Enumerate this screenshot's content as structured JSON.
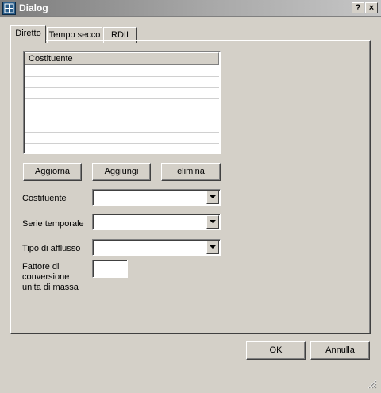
{
  "window": {
    "title": "Dialog",
    "help_label": "?",
    "close_label": "×"
  },
  "tabs": [
    {
      "label": "Diretto",
      "active": true
    },
    {
      "label": "Tempo secco",
      "active": false
    },
    {
      "label": "RDII",
      "active": false
    }
  ],
  "list": {
    "header": "Costituente",
    "rows": []
  },
  "buttons": {
    "aggiorna": "Aggiorna",
    "aggiungi": "Aggiungi",
    "elimina": "elimina",
    "ok": "OK",
    "annulla": "Annulla"
  },
  "fields": {
    "costituente": {
      "label": "Costituente",
      "value": ""
    },
    "serie_temporale": {
      "label": "Serie temporale",
      "value": ""
    },
    "tipo_afflusso": {
      "label": "Tipo di afflusso",
      "value": ""
    },
    "fattore": {
      "label_lines": [
        "Fattore di",
        "conversione",
        "unita di massa"
      ],
      "value": ""
    }
  },
  "colors": {
    "face": "#d4d0c8",
    "title_gradient_start": "#7d7d7d",
    "title_gradient_end": "#c6c6c6"
  }
}
